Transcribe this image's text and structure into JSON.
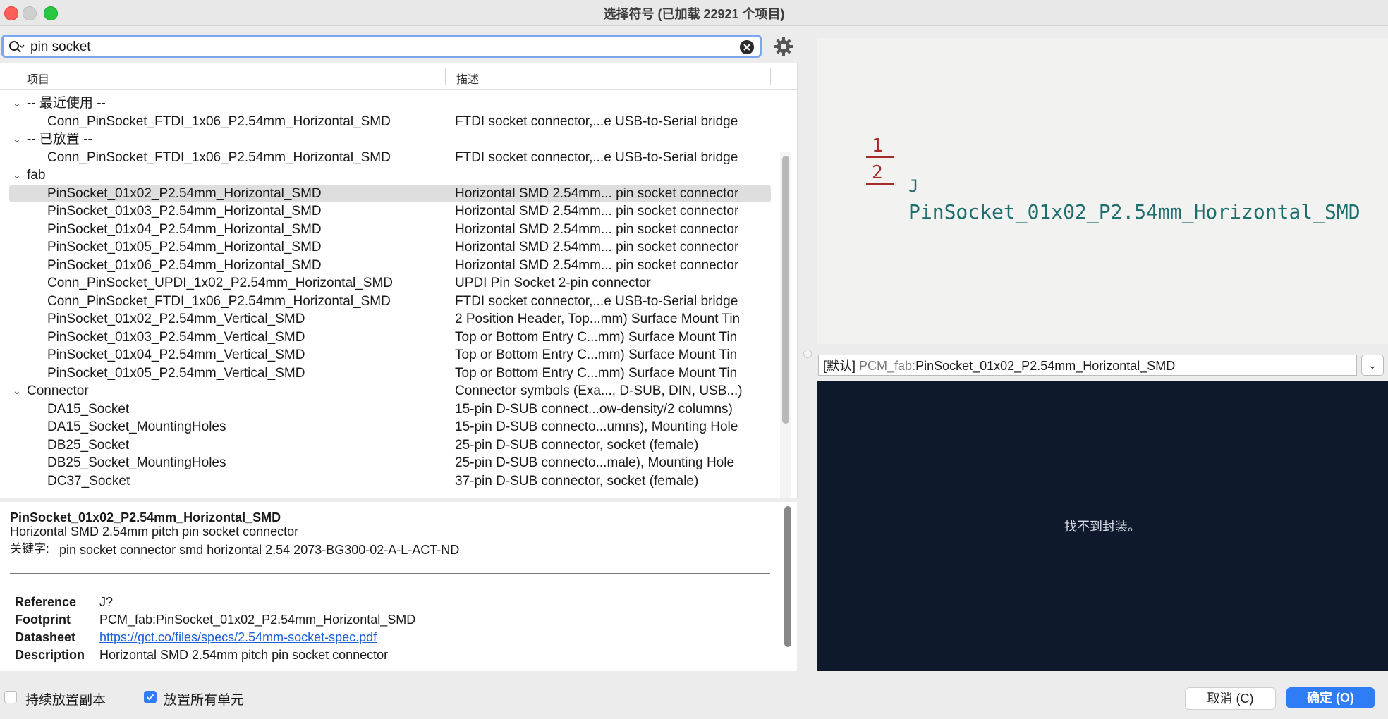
{
  "window": {
    "title": "选择符号 (已加载 22921 个项目)"
  },
  "search": {
    "value": "pin socket",
    "icon": "search-icon"
  },
  "columns": {
    "item": "项目",
    "description": "描述"
  },
  "rows": [
    {
      "type": "group",
      "name": "-- 最近使用 --",
      "desc": ""
    },
    {
      "type": "item",
      "name": "Conn_PinSocket_FTDI_1x06_P2.54mm_Horizontal_SMD",
      "desc": "FTDI socket connector,...e USB-to-Serial bridge"
    },
    {
      "type": "group",
      "name": "-- 已放置 --",
      "desc": ""
    },
    {
      "type": "item",
      "name": "Conn_PinSocket_FTDI_1x06_P2.54mm_Horizontal_SMD",
      "desc": "FTDI socket connector,...e USB-to-Serial bridge"
    },
    {
      "type": "group",
      "name": "fab",
      "desc": ""
    },
    {
      "type": "item",
      "selected": true,
      "name": "PinSocket_01x02_P2.54mm_Horizontal_SMD",
      "desc": "Horizontal SMD 2.54mm... pin socket connector"
    },
    {
      "type": "item",
      "name": "PinSocket_01x03_P2.54mm_Horizontal_SMD",
      "desc": "Horizontal SMD 2.54mm... pin socket connector"
    },
    {
      "type": "item",
      "name": "PinSocket_01x04_P2.54mm_Horizontal_SMD",
      "desc": "Horizontal SMD 2.54mm... pin socket connector"
    },
    {
      "type": "item",
      "name": "PinSocket_01x05_P2.54mm_Horizontal_SMD",
      "desc": "Horizontal SMD 2.54mm... pin socket connector"
    },
    {
      "type": "item",
      "name": "PinSocket_01x06_P2.54mm_Horizontal_SMD",
      "desc": "Horizontal SMD 2.54mm... pin socket connector"
    },
    {
      "type": "item",
      "name": "Conn_PinSocket_UPDI_1x02_P2.54mm_Horizontal_SMD",
      "desc": "UPDI Pin Socket 2-pin connector"
    },
    {
      "type": "item",
      "name": "Conn_PinSocket_FTDI_1x06_P2.54mm_Horizontal_SMD",
      "desc": "FTDI socket connector,...e USB-to-Serial bridge"
    },
    {
      "type": "item",
      "name": "PinSocket_01x02_P2.54mm_Vertical_SMD",
      "desc": "2 Position Header, Top...mm) Surface Mount Tin"
    },
    {
      "type": "item",
      "name": "PinSocket_01x03_P2.54mm_Vertical_SMD",
      "desc": "Top or Bottom Entry C...mm) Surface Mount Tin"
    },
    {
      "type": "item",
      "name": "PinSocket_01x04_P2.54mm_Vertical_SMD",
      "desc": "Top or Bottom Entry C...mm) Surface Mount Tin"
    },
    {
      "type": "item",
      "name": "PinSocket_01x05_P2.54mm_Vertical_SMD",
      "desc": "Top or Bottom Entry C...mm) Surface Mount Tin"
    },
    {
      "type": "group",
      "name": "Connector",
      "desc": "Connector symbols (Exa..., D-SUB, DIN, USB...)"
    },
    {
      "type": "item",
      "name": "DA15_Socket",
      "desc": "15-pin D-SUB connect...ow-density/2 columns)"
    },
    {
      "type": "item",
      "name": "DA15_Socket_MountingHoles",
      "desc": "15-pin D-SUB connecto...umns), Mounting Hole"
    },
    {
      "type": "item",
      "name": "DB25_Socket",
      "desc": "25-pin D-SUB connector, socket (female)"
    },
    {
      "type": "item",
      "name": "DB25_Socket_MountingHoles",
      "desc": "25-pin D-SUB connecto...male), Mounting Hole"
    },
    {
      "type": "item",
      "name": "DC37_Socket",
      "desc": "37-pin D-SUB connector, socket (female)"
    }
  ],
  "details": {
    "title": "PinSocket_01x02_P2.54mm_Horizontal_SMD",
    "subtitle": "Horizontal SMD 2.54mm pitch pin socket connector",
    "keywords_label": "关键字:",
    "keywords": "pin socket connector smd horizontal 2.54 2073-BG300-02-A-L-ACT-ND",
    "fields": [
      {
        "label": "Reference",
        "value": "J?"
      },
      {
        "label": "Footprint",
        "value": "PCM_fab:PinSocket_01x02_P2.54mm_Horizontal_SMD"
      },
      {
        "label": "Datasheet",
        "value": "https://gct.co/files/specs/2.54mm-socket-spec.pdf",
        "link": true
      },
      {
        "label": "Description",
        "value": "Horizontal SMD 2.54mm pitch pin socket connector"
      }
    ]
  },
  "preview": {
    "pin1": "1",
    "pin2": "2",
    "ref": "J",
    "value": "PinSocket_01x02_P2.54mm_Horizontal_SMD",
    "pin_color": "#a52a2a",
    "text_color": "#1e6e6e"
  },
  "footprint": {
    "prefix": "[默认]",
    "lib": "PCM_fab:",
    "name": "PinSocket_01x02_P2.54mm_Horizontal_SMD",
    "empty_message": "找不到封装。",
    "bg_color": "#0e1a2c"
  },
  "bottom": {
    "keep_copies_label": "持续放置副本",
    "keep_copies_checked": false,
    "place_all_units_label": "放置所有单元",
    "place_all_units_checked": true,
    "cancel_label": "取消 (C)",
    "ok_label": "确定 (O)",
    "accent": "#2e7cf6"
  }
}
